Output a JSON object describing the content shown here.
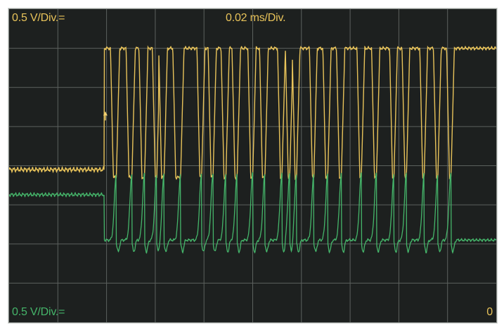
{
  "readouts": {
    "channel1_scale": "0.5 V/Div.=",
    "timebase": "0.02 ms/Div.",
    "channel2_scale": "0.5 V/Div.=",
    "offset": "0"
  },
  "colors": {
    "background": "#1d201f",
    "grid": "#5c615e",
    "channel1": "#e8c35a",
    "channel2": "#45b56a",
    "trigger_marker": "#f2d070"
  },
  "chart_data": {
    "type": "line",
    "title": "",
    "xlabel": "",
    "ylabel": "",
    "grid": true,
    "grid_divisions": {
      "x": 10,
      "y": 8
    },
    "x_unit": "ms",
    "y_unit": "V",
    "xlim": [
      0,
      0.2
    ],
    "ylim": [
      -2,
      2
    ],
    "trigger": {
      "time_ms": 0.0395,
      "channel": "channel1",
      "volts": 0.65
    },
    "series": [
      {
        "id": "channel1",
        "volts_per_div": 0.5,
        "low_level_v": -0.15,
        "high_level_v": 1.5,
        "initial_level_v": -0.05,
        "rising_edge_ms": 0.039,
        "pulses_ms": [
          [
            0.0428,
            0.044
          ],
          [
            0.0492,
            0.0504
          ],
          [
            0.0545,
            0.0556
          ],
          [
            0.06,
            0.0606
          ],
          [
            0.0626,
            0.0636
          ],
          [
            0.0684,
            0.0704
          ],
          [
            0.0783,
            0.079
          ],
          [
            0.0829,
            0.0837
          ],
          [
            0.0882,
            0.089
          ],
          [
            0.0927,
            0.0936
          ],
          [
            0.0992,
            0.1
          ],
          [
            0.104,
            0.105
          ],
          [
            0.1114,
            0.112
          ],
          [
            0.1146,
            0.1152
          ],
          [
            0.1174,
            0.118
          ],
          [
            0.1245,
            0.1251
          ],
          [
            0.13,
            0.1308
          ],
          [
            0.1356,
            0.1364
          ],
          [
            0.144,
            0.1446
          ],
          [
            0.15,
            0.1508
          ],
          [
            0.1574,
            0.158
          ],
          [
            0.1625,
            0.1631
          ],
          [
            0.1698,
            0.1704
          ],
          [
            0.1754,
            0.176
          ],
          [
            0.1808,
            0.1814
          ]
        ]
      },
      {
        "id": "channel2",
        "volts_per_div": 0.5,
        "initial_level_v": -0.37,
        "base_level_v": -0.95,
        "peak_level_v": -0.1,
        "trough_level_v": -1.1,
        "step_down_ms": 0.039
      }
    ]
  }
}
